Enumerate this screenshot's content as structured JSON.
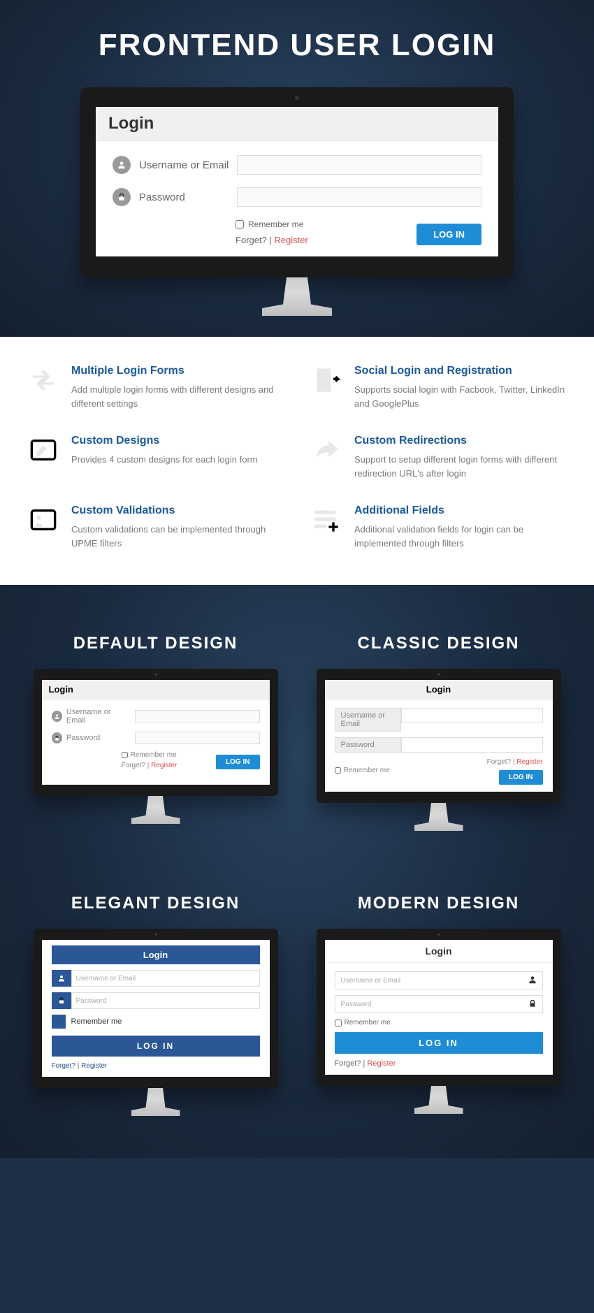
{
  "hero": {
    "title": "FRONTEND USER LOGIN"
  },
  "loginForm": {
    "heading": "Login",
    "usernameLabel": "Username or Email",
    "passwordLabel": "Password",
    "remember": "Remember me",
    "forget": "Forget?",
    "separator": " | ",
    "register": "Register",
    "button": "LOG IN"
  },
  "features": [
    {
      "title": "Multiple Login Forms",
      "desc": "Add multiple login forms with different designs and different settings"
    },
    {
      "title": "Social Login and Registration",
      "desc": "Supports social login with Facbook, Twitter, LinkedIn and GooglePlus"
    },
    {
      "title": "Custom Designs",
      "desc": "Provides 4 custom designs for each login form"
    },
    {
      "title": "Custom Redirections",
      "desc": "Support to setup different login forms with different redirection URL's after login"
    },
    {
      "title": "Custom Validations",
      "desc": "Custom validations can be implemented through UPME filters"
    },
    {
      "title": "Additional Fields",
      "desc": "Additional validation fields for login can be implemented through filters"
    }
  ],
  "designs": {
    "default": {
      "title": "DEFAULT DESIGN"
    },
    "classic": {
      "title": "CLASSIC DESIGN"
    },
    "elegant": {
      "title": "ELEGANT DESIGN"
    },
    "modern": {
      "title": "MODERN DESIGN"
    }
  }
}
